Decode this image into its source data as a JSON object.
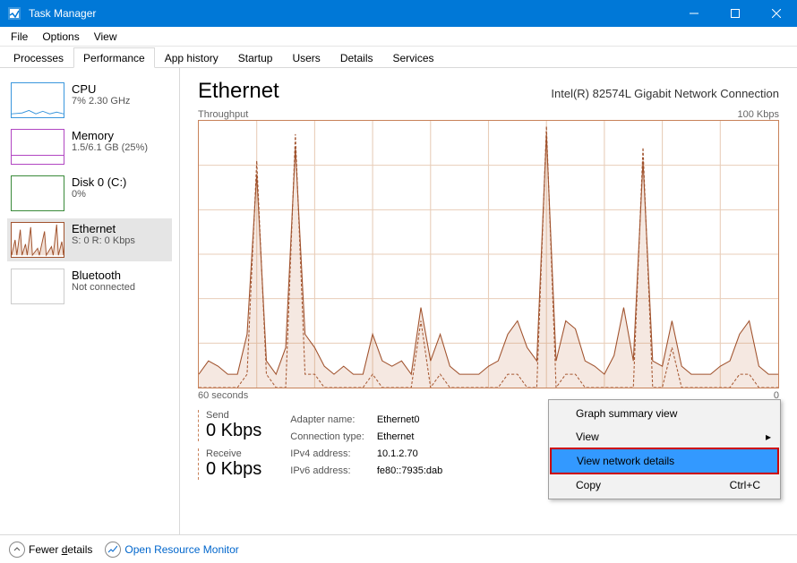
{
  "window": {
    "title": "Task Manager"
  },
  "menubar": [
    "File",
    "Options",
    "View"
  ],
  "tabs": [
    "Processes",
    "Performance",
    "App history",
    "Startup",
    "Users",
    "Details",
    "Services"
  ],
  "active_tab": 1,
  "sidebar": [
    {
      "name": "CPU",
      "sub": "7% 2.30 GHz",
      "color": "#3a96dd"
    },
    {
      "name": "Memory",
      "sub": "1.5/6.1 GB (25%)",
      "color": "#b146c2"
    },
    {
      "name": "Disk 0 (C:)",
      "sub": "0%",
      "color": "#3a8a3a"
    },
    {
      "name": "Ethernet",
      "sub": "S: 0 R: 0 Kbps",
      "color": "#a0522d"
    },
    {
      "name": "Bluetooth",
      "sub": "Not connected",
      "color": "#bbbbbb"
    }
  ],
  "selected_sidebar": 3,
  "detail": {
    "title": "Ethernet",
    "hw": "Intel(R) 82574L Gigabit Network Connection",
    "chart_top_left": "Throughput",
    "chart_top_right": "100 Kbps",
    "xaxis_left": "60 seconds",
    "xaxis_right": "0",
    "send_label": "Send",
    "send_value": "0 Kbps",
    "recv_label": "Receive",
    "recv_value": "0 Kbps",
    "props": [
      [
        "Adapter name:",
        "Ethernet0"
      ],
      [
        "Connection type:",
        "Ethernet"
      ],
      [
        "IPv4 address:",
        "10.1.2.70"
      ],
      [
        "IPv6 address:",
        "fe80::7935:dab"
      ]
    ]
  },
  "context_menu": {
    "items": [
      {
        "label": "Graph summary view"
      },
      {
        "label": "View",
        "submenu": true
      },
      {
        "label": "View network details",
        "highlight": true
      },
      {
        "label": "Copy",
        "shortcut": "Ctrl+C"
      }
    ]
  },
  "footer": {
    "fewer": "Fewer details",
    "orm": "Open Resource Monitor"
  },
  "chart_data": {
    "type": "line",
    "title": "Throughput",
    "xlabel": "seconds",
    "ylabel": "Kbps",
    "xlim": [
      0,
      60
    ],
    "ylim": [
      0,
      100
    ],
    "x": [
      0,
      1,
      2,
      3,
      4,
      5,
      6,
      7,
      8,
      9,
      10,
      11,
      12,
      13,
      14,
      15,
      16,
      17,
      18,
      19,
      20,
      21,
      22,
      23,
      24,
      25,
      26,
      27,
      28,
      29,
      30,
      31,
      32,
      33,
      34,
      35,
      36,
      37,
      38,
      39,
      40,
      41,
      42,
      43,
      44,
      45,
      46,
      47,
      48,
      49,
      50,
      51,
      52,
      53,
      54,
      55,
      56,
      57,
      58,
      59,
      60
    ],
    "series": [
      {
        "name": "Send",
        "style": "dashed",
        "values": [
          0,
          0,
          0,
          0,
          0,
          5,
          85,
          5,
          0,
          0,
          95,
          5,
          5,
          0,
          0,
          0,
          0,
          0,
          5,
          0,
          0,
          0,
          0,
          25,
          0,
          5,
          0,
          0,
          0,
          0,
          0,
          0,
          5,
          5,
          0,
          0,
          98,
          0,
          5,
          5,
          0,
          0,
          0,
          0,
          0,
          0,
          90,
          0,
          0,
          15,
          0,
          0,
          0,
          0,
          0,
          0,
          5,
          5,
          0,
          0,
          0
        ]
      },
      {
        "name": "Receive",
        "style": "solid",
        "values": [
          5,
          10,
          8,
          5,
          5,
          20,
          80,
          10,
          5,
          15,
          90,
          20,
          15,
          8,
          5,
          8,
          5,
          5,
          20,
          10,
          8,
          10,
          5,
          30,
          10,
          20,
          8,
          5,
          5,
          5,
          8,
          10,
          20,
          25,
          15,
          10,
          95,
          10,
          25,
          22,
          10,
          8,
          5,
          12,
          30,
          10,
          85,
          10,
          8,
          25,
          8,
          5,
          5,
          5,
          8,
          10,
          20,
          25,
          8,
          5,
          5
        ]
      }
    ]
  }
}
